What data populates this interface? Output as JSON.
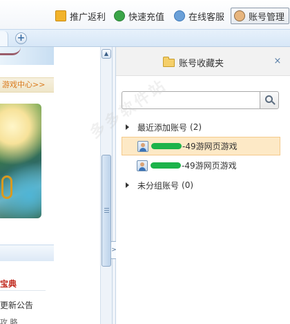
{
  "toolbar": {
    "promo_label": "推广返利",
    "recharge_label": "快速充值",
    "service_label": "在线客服",
    "account_label": "账号管理"
  },
  "tabstrip": {
    "add_tab_label": "+"
  },
  "webpage": {
    "game_center_link": "游戏中心>>",
    "guide_title": "宝典",
    "announcement": "更新公告",
    "announcement_partial": "攻 略"
  },
  "favorites_panel": {
    "title": "账号收藏夹",
    "close_glyph": "×",
    "search": {
      "value": "",
      "placeholder": ""
    },
    "groups": [
      {
        "label": "最近添加账号",
        "count": "(2)",
        "accounts": [
          {
            "suffix": "-49游网页游戏",
            "selected": true
          },
          {
            "suffix": "-49游网页游戏",
            "selected": false
          }
        ]
      },
      {
        "label": "未分组账号",
        "count": "(0)"
      }
    ]
  },
  "colors": {
    "selected_row_bg": "#fde9c6",
    "game_center_text": "#d9791b",
    "guide_title_text": "#c0281c"
  },
  "watermark": "多多软件站"
}
